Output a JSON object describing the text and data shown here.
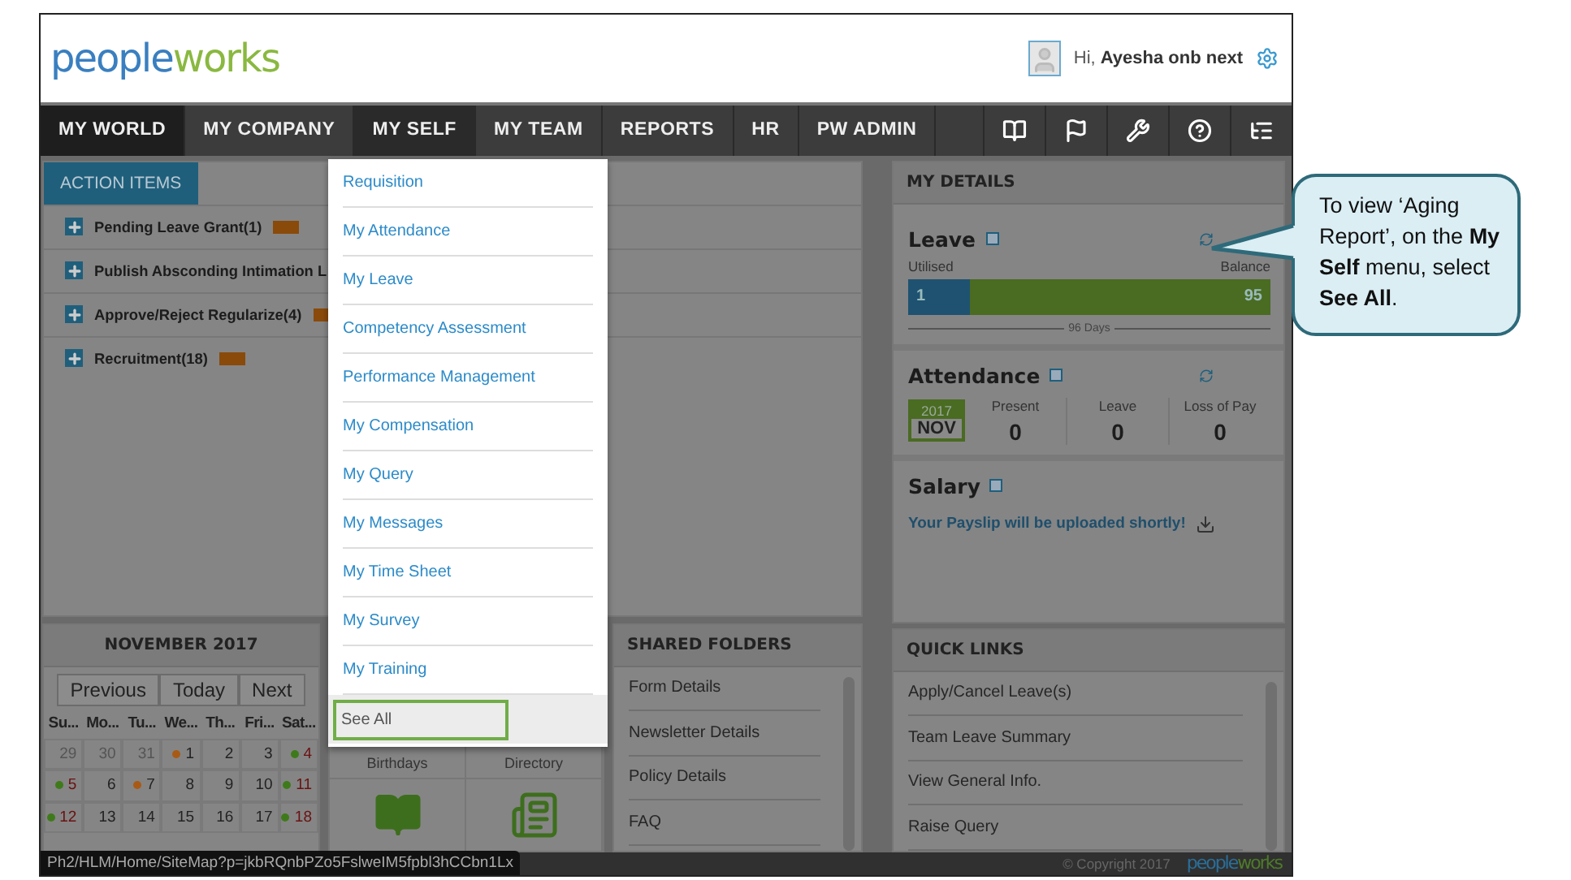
{
  "header": {
    "logo": {
      "part1": "people",
      "part2": "works"
    },
    "greeting": "Hi, **Ayesha onb next**"
  },
  "nav": {
    "items": [
      {
        "label": "MY WORLD",
        "selected": true,
        "open": false
      },
      {
        "label": "MY COMPANY",
        "selected": false,
        "open": false
      },
      {
        "label": "MY SELF",
        "selected": false,
        "open": true
      },
      {
        "label": "MY TEAM",
        "selected": false,
        "open": false
      },
      {
        "label": "REPORTS",
        "selected": false,
        "open": false
      },
      {
        "label": "HR",
        "selected": false,
        "open": false
      },
      {
        "label": "PW ADMIN",
        "selected": false,
        "open": false
      }
    ]
  },
  "action_items": {
    "title": "ACTION ITEMS",
    "items": [
      {
        "label": "Pending Leave Grant(1)",
        "new": true
      },
      {
        "label": "Publish Absconding Intimation L"
      },
      {
        "label": "Approve/Reject Regularize(4)",
        "new": true
      },
      {
        "label": "Recruitment(18)",
        "new": true
      }
    ]
  },
  "dropdown": {
    "items": [
      {
        "label": "Requisition",
        "highlighted": false
      },
      {
        "label": "My Attendance",
        "highlighted": false
      },
      {
        "label": "My Leave",
        "highlighted": false
      },
      {
        "label": "Competency Assessment",
        "highlighted": false
      },
      {
        "label": "Performance Management",
        "highlighted": false
      },
      {
        "label": "My Compensation",
        "highlighted": false
      },
      {
        "label": "My Query",
        "highlighted": false
      },
      {
        "label": "My Messages",
        "highlighted": false
      },
      {
        "label": "My Time Sheet",
        "highlighted": false
      },
      {
        "label": "My Survey",
        "highlighted": false
      },
      {
        "label": "My Training",
        "highlighted": false
      },
      {
        "label": "See All",
        "highlighted": true
      }
    ]
  },
  "calendar": {
    "title": "NOVEMBER 2017",
    "buttons": [
      "Previous",
      "Today",
      "Next"
    ],
    "weekdays": [
      "Su...",
      "Mo...",
      "Tu...",
      "We...",
      "Th...",
      "Fri...",
      "Sat..."
    ],
    "weeks": [
      [
        {
          "day": "29",
          "other_month": true
        },
        {
          "day": "30",
          "other_month": true
        },
        {
          "day": "31",
          "other_month": true
        },
        {
          "day": "1",
          "other_month": false,
          "color": "#a85a14"
        },
        {
          "day": "2",
          "other_month": false
        },
        {
          "day": "3",
          "other_month": false
        },
        {
          "day": "4",
          "other_month": false,
          "color": "#3f7a1a"
        }
      ],
      [
        {
          "day": "5",
          "other_month": false,
          "color": "#3f7a1a"
        },
        {
          "day": "6",
          "other_month": false
        },
        {
          "day": "7",
          "other_month": false,
          "color": "#a85a14"
        },
        {
          "day": "8",
          "other_month": false
        },
        {
          "day": "9",
          "other_month": false
        },
        {
          "day": "10",
          "other_month": false
        },
        {
          "day": "11",
          "other_month": false,
          "color": "#3f7a1a"
        }
      ],
      [
        {
          "day": "12",
          "other_month": false,
          "color": "#3f7a1a"
        },
        {
          "day": "13",
          "other_month": false
        },
        {
          "day": "14",
          "other_month": false
        },
        {
          "day": "15",
          "other_month": false
        },
        {
          "day": "16",
          "other_month": false
        },
        {
          "day": "17",
          "other_month": false
        },
        {
          "day": "18",
          "other_month": false,
          "color": "#3f7a1a"
        }
      ]
    ]
  },
  "people_panel": {
    "tiles": [
      {
        "label": "Birthdays",
        "kind": "book"
      },
      {
        "label": "Directory",
        "kind": "news"
      }
    ]
  },
  "shared_folders": {
    "title": "SHARED FOLDERS",
    "items": [
      "Form Details",
      "Newsletter Details",
      "Policy Details",
      "FAQ"
    ]
  },
  "my_details": {
    "title": "MY DETAILS",
    "leave": {
      "title": "Leave",
      "utilised_label": "Utilised",
      "balance_label": "Balance",
      "utilised": "1",
      "balance": "95",
      "level": 0.17,
      "total": "96 Days"
    },
    "attendance": {
      "title": "Attendance",
      "year": "2017",
      "month": "NOV",
      "stats": [
        {
          "label": "Present",
          "value": "0"
        },
        {
          "label": "Leave",
          "value": "0"
        },
        {
          "label": "Loss of Pay",
          "value": "0"
        }
      ]
    },
    "salary": {
      "title": "Salary",
      "message": "Your Payslip will be uploaded shortly!"
    }
  },
  "quick_links": {
    "title": "QUICK LINKS",
    "items": [
      "Apply/Cancel Leave(s)",
      "Team Leave Summary",
      "View General Info.",
      "Raise Query"
    ]
  },
  "footer": {
    "copyright": "© Copyright 2017",
    "logo": {
      "part1": "people",
      "part2": "works"
    }
  },
  "status_url": "Ph2/HLM/Home/SiteMap?p=jkbRQnbPZo5FslweIM5fpbl3hCCbn1Lx",
  "callout": "To view ‘Aging Report’, on the **My Self** menu, select **See All**."
}
